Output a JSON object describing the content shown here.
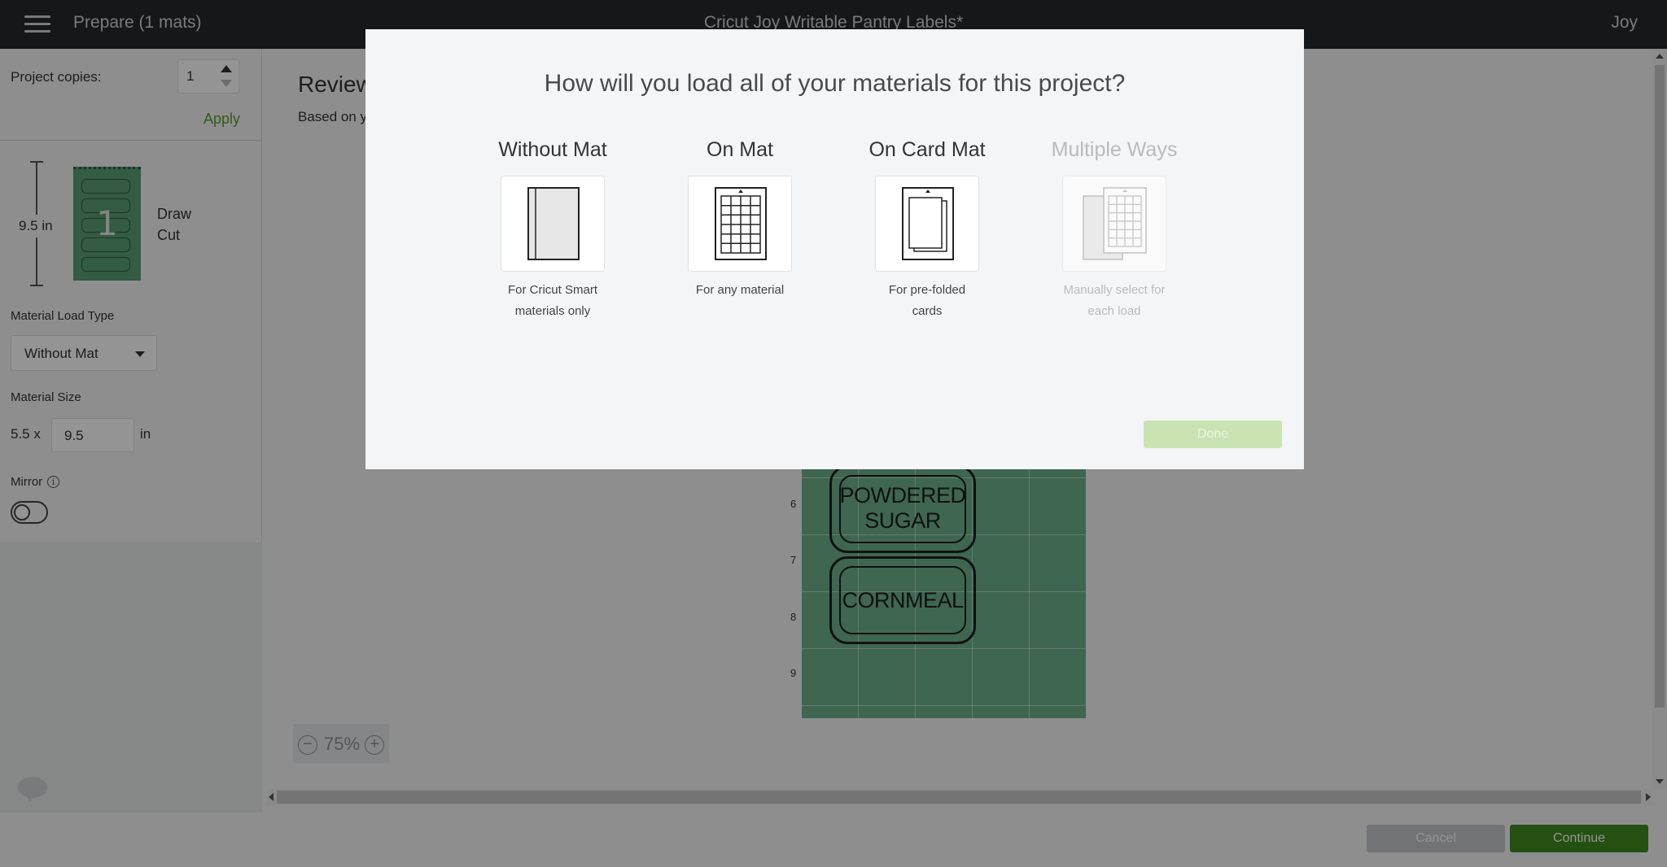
{
  "header": {
    "prepare_title": "Prepare (1 mats)",
    "project_title": "Cricut Joy Writable Pantry Labels*",
    "machine_name": "Joy"
  },
  "sidebar": {
    "copies_label": "Project copies:",
    "copies_value": "1",
    "apply_label": "Apply",
    "mat_height_label": "9.5 in",
    "mat_number": "1",
    "mat_ops": [
      "Draw",
      "Cut"
    ],
    "material_load_type_label": "Material Load Type",
    "material_load_type_value": "Without Mat",
    "material_size_label": "Material Size",
    "material_width": "5.5 x",
    "material_height_value": "9.5",
    "material_unit": "in",
    "mirror_label": "Mirror",
    "info_icon_glyph": "i"
  },
  "main": {
    "review_title": "Review",
    "based_text": "Based on y",
    "labels": [
      {
        "text_lines": [
          "POWDERED",
          "SUGAR"
        ]
      },
      {
        "text_lines": [
          "CORNMEAL"
        ]
      }
    ],
    "ruler": [
      "6",
      "7",
      "8",
      "9"
    ],
    "zoom": {
      "value": "75%",
      "minus": "−",
      "plus": "+"
    }
  },
  "footer": {
    "cancel_label": "Cancel",
    "continue_label": "Continue"
  },
  "modal": {
    "question": "How will you load all of your materials for this project?",
    "options": [
      {
        "title": "Without Mat",
        "desc_lines": [
          "For Cricut Smart",
          "materials only"
        ],
        "icon": "without-mat-icon",
        "enabled": true
      },
      {
        "title": "On Mat",
        "desc_lines": [
          "For any material"
        ],
        "icon": "on-mat-icon",
        "enabled": true
      },
      {
        "title": "On Card Mat",
        "desc_lines": [
          "For pre-folded",
          "cards"
        ],
        "icon": "card-mat-icon",
        "enabled": true
      },
      {
        "title": "Multiple Ways",
        "desc_lines": [
          "Manually select for",
          "each load"
        ],
        "icon": "multiple-ways-icon",
        "enabled": false
      }
    ],
    "done_label": "Done"
  },
  "colors": {
    "topbar": "#252a30",
    "accent_green": "#3f8a1e",
    "apply_green": "#5f9c2e",
    "mat_green": "#6bb08a"
  }
}
